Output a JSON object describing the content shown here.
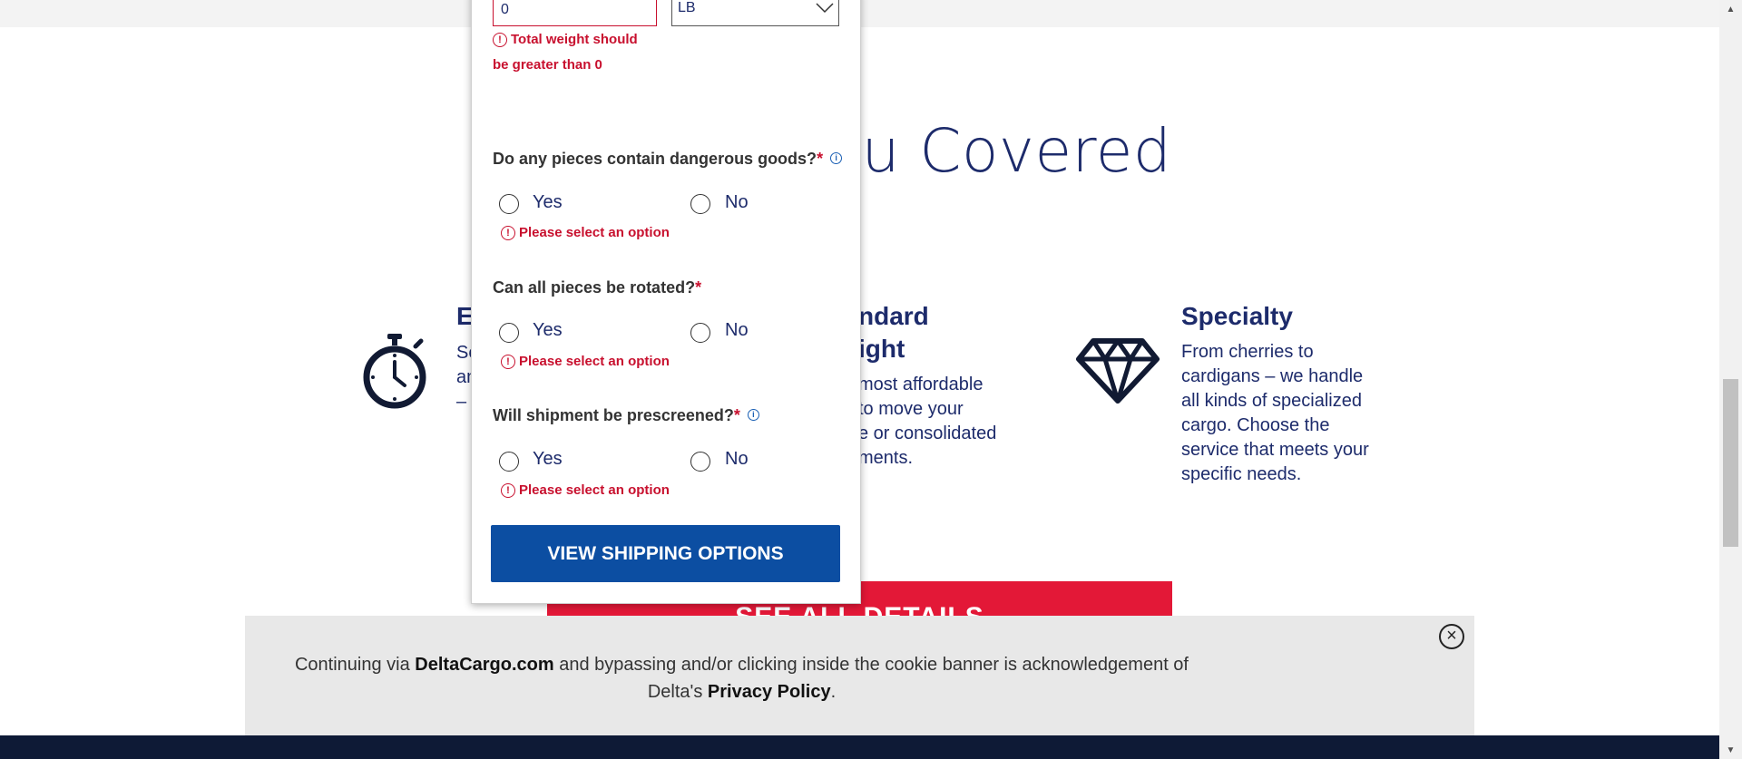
{
  "page": {
    "hero_title": "ou Covered"
  },
  "features": [
    {
      "heading": "E",
      "text_lines": [
        "Se",
        "an",
        "–"
      ]
    },
    {
      "heading_lines": [
        "ndard",
        "ight"
      ],
      "text_lines": [
        "most affordable",
        "to move your",
        "e or consolidated",
        "ments."
      ]
    },
    {
      "heading": "Specialty",
      "text_lines": [
        "From cherries to",
        "cardigans – we handle",
        "all kinds of specialized",
        "cargo. Choose the",
        "service that meets your",
        "specific needs."
      ]
    }
  ],
  "see_all_button": "SEE ALL DETAILS",
  "form": {
    "weight_value": "0",
    "unit_value": "LB",
    "weight_error_lines": [
      "Total weight should",
      "be greater than 0"
    ],
    "questions": [
      {
        "label": "Do any pieces contain dangerous goods?",
        "required_mark": "*",
        "has_info": true,
        "yes": "Yes",
        "no": "No",
        "error": "Please select an option"
      },
      {
        "label": "Can all pieces be rotated?",
        "required_mark": "*",
        "has_info": false,
        "yes": "Yes",
        "no": "No",
        "error": "Please select an option"
      },
      {
        "label": "Will shipment be prescreened?",
        "required_mark": "*",
        "has_info": true,
        "yes": "Yes",
        "no": "No",
        "error": "Please select an option"
      }
    ],
    "submit_label": "VIEW SHIPPING OPTIONS"
  },
  "cookie_banner": {
    "text_before": "Continuing via ",
    "brand": "DeltaCargo.com",
    "text_middle": " and bypassing and/or clicking inside the cookie banner is acknowledgement of",
    "text_line2_before": "Delta's ",
    "policy_link": "Privacy Policy",
    "text_end": ".",
    "close_symbol": "×"
  },
  "colors": {
    "navy": "#1d2b6b",
    "error_red": "#c8102e",
    "primary_blue": "#0c4ea2",
    "delta_red": "#e31837"
  },
  "icons": {
    "stopwatch": "stopwatch-icon",
    "diamond": "diamond-icon",
    "error": "error-circle-icon",
    "info": "info-icon",
    "close": "close-circle-icon"
  }
}
